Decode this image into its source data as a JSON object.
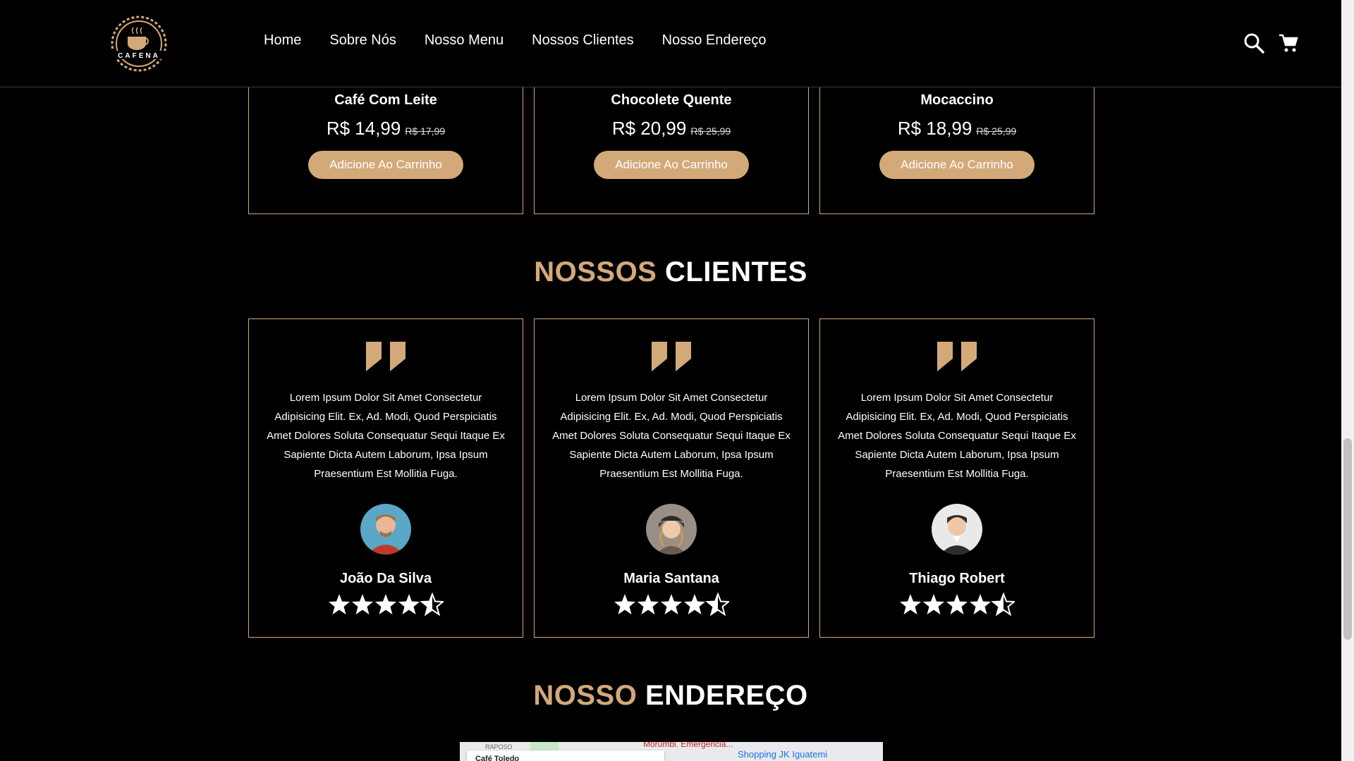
{
  "brand": {
    "logo_text": "CAFENA"
  },
  "nav": {
    "items": [
      "Home",
      "Sobre Nós",
      "Nosso Menu",
      "Nossos Clientes",
      "Nosso Endereço"
    ]
  },
  "header_icons": {
    "search": "search-icon",
    "cart": "cart-icon"
  },
  "products": [
    {
      "name": "Café Com Leite",
      "price": "R$ 14,99",
      "old_price": "R$ 17,99",
      "button": "Adicione Ao Carrinho"
    },
    {
      "name": "Chocolete Quente",
      "price": "R$ 20,99",
      "old_price": "R$ 25,99",
      "button": "Adicione Ao Carrinho"
    },
    {
      "name": "Mocaccino",
      "price": "R$ 18,99",
      "old_price": "R$ 25,99",
      "button": "Adicione Ao Carrinho"
    }
  ],
  "clients_section": {
    "title_accent": "NOSSOS",
    "title_rest": "CLIENTES"
  },
  "reviews": [
    {
      "text": "Lorem Ipsum Dolor Sit Amet Consectetur Adipisicing Elit. Ex, Ad. Modi, Quod Perspiciatis Amet Dolores Soluta Consequatur Sequi Itaque Ex Sapiente Dicta Autem Laborum, Ipsa Ipsum Praesentium Est Mollitia Fuga.",
      "name": "João Da Silva",
      "rating": 4.5
    },
    {
      "text": "Lorem Ipsum Dolor Sit Amet Consectetur Adipisicing Elit. Ex, Ad. Modi, Quod Perspiciatis Amet Dolores Soluta Consequatur Sequi Itaque Ex Sapiente Dicta Autem Laborum, Ipsa Ipsum Praesentium Est Mollitia Fuga.",
      "name": "Maria Santana",
      "rating": 4.5
    },
    {
      "text": "Lorem Ipsum Dolor Sit Amet Consectetur Adipisicing Elit. Ex, Ad. Modi, Quod Perspiciatis Amet Dolores Soluta Consequatur Sequi Itaque Ex Sapiente Dicta Autem Laborum, Ipsa Ipsum Praesentium Est Mollitia Fuga.",
      "name": "Thiago Robert",
      "rating": 4.5
    }
  ],
  "address_section": {
    "title_accent": "NOSSO",
    "title_rest": "ENDEREÇO"
  },
  "map": {
    "label_road": "RAPOSO",
    "label_hospital": "Morumbi. Emergência...",
    "label_mall": "Shopping JK Iguatemi",
    "card_title": "Café Toledo"
  },
  "colors": {
    "accent": "#d3a97a",
    "background": "#000000",
    "text": "#ffffff"
  }
}
